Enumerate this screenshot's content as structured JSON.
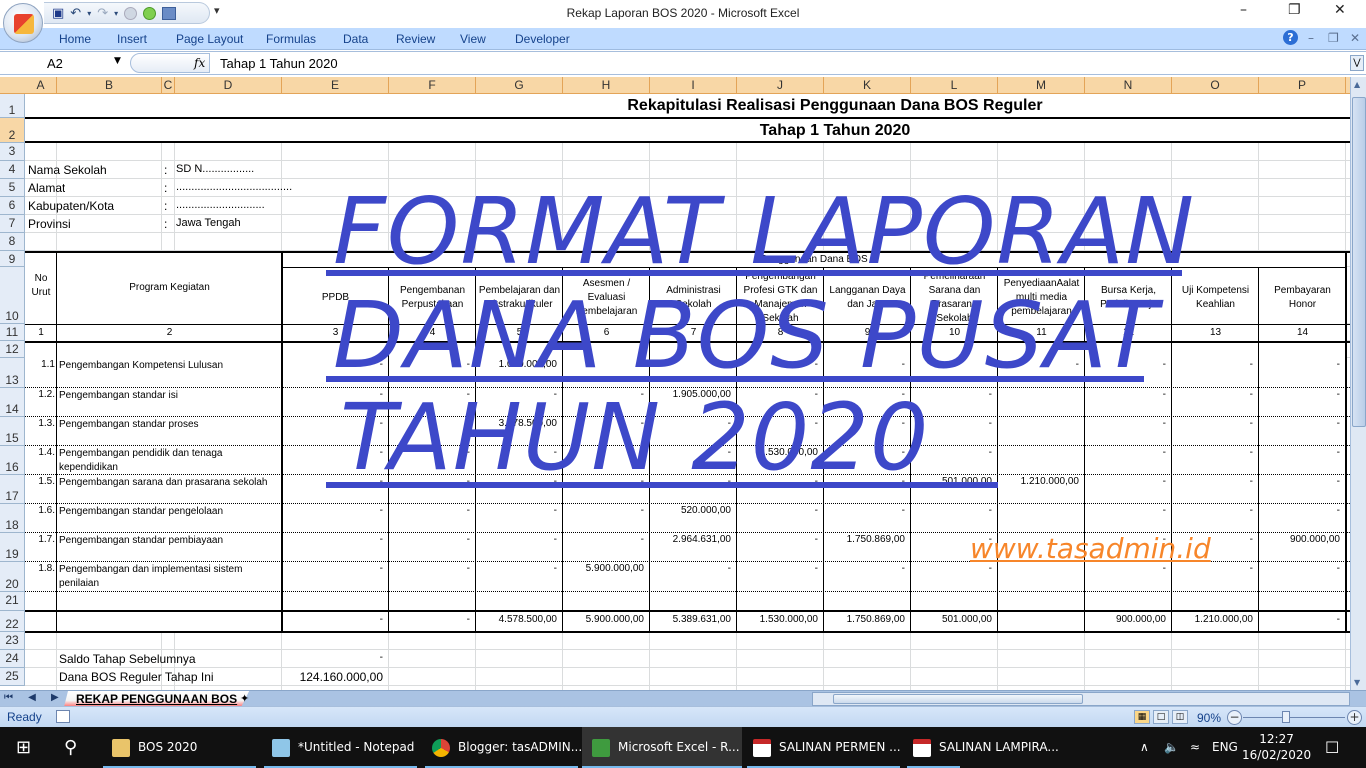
{
  "window": {
    "title": "Rekap Laporan BOS 2020 - Microsoft Excel",
    "minimize_icon": "minimize-icon",
    "restore_icon": "restore-icon",
    "close_icon": "close-icon"
  },
  "quick_access": {
    "save": "💾",
    "undo": "↶",
    "redo": "↷",
    "more": "≡"
  },
  "ribbon": {
    "tabs": [
      "Home",
      "Insert",
      "Page Layout",
      "Formulas",
      "Data",
      "Review",
      "View",
      "Developer"
    ],
    "help": "?"
  },
  "formula_bar": {
    "name_box": "A2",
    "fx": "fx",
    "value": "Tahap 1 Tahun 2020"
  },
  "columns": [
    "A",
    "B",
    "C",
    "D",
    "E",
    "F",
    "G",
    "H",
    "I",
    "J",
    "K",
    "L",
    "M",
    "N",
    "O",
    "P"
  ],
  "rows": [
    "1",
    "2",
    "3",
    "4",
    "5",
    "6",
    "7",
    "8",
    "9",
    "10",
    "11",
    "12",
    "13",
    "14",
    "15",
    "16",
    "17",
    "18",
    "19",
    "20",
    "21",
    "22",
    "23",
    "24",
    "25"
  ],
  "sheet": {
    "title": "Rekapitulasi Realisasi Penggunaan Dana BOS Reguler",
    "subtitle": "Tahap 1 Tahun 2020",
    "info": [
      {
        "label": "Nama Sekolah",
        "sep": ":",
        "value": "SD N................."
      },
      {
        "label": "Alamat",
        "sep": ":",
        "value": "......................................"
      },
      {
        "label": "Kabupaten/Kota",
        "sep": ":",
        "value": "............................."
      },
      {
        "label": "Provinsi",
        "sep": ":",
        "value": "Jawa Tengah"
      }
    ],
    "header": {
      "no_urut": "No Urut",
      "program": "Program Kegiatan",
      "group": "Penggunaan Dana BOS",
      "cols": [
        "PPDB",
        "Pengembanan Perpustakaan",
        "Pembelajaran dan Ekstrakurikuler",
        "Asesmen / Evaluasi Pembelajaran",
        "Administrasi Sekolah",
        "Pengembangan Profesi GTK dan Manajemen Sekolah",
        "Langganan Daya dan Jasa",
        "Pemeliharaan Sarana dan Prasarana Sekolah",
        "PenyediaanAalat multi media pembelajaran",
        "Bursa Kerja, Praktik Kerja",
        "Uji Kompetensi Keahlian",
        "Pembayaran Honor"
      ],
      "numbers": [
        "1",
        "2",
        "3",
        "4",
        "5",
        "6",
        "7",
        "8",
        "9",
        "10",
        "11",
        "12",
        "13",
        "14"
      ]
    },
    "items": [
      {
        "no": "1.1",
        "name": "Pengembangan Kompetensi Lulusan",
        "values": [
          "-",
          "-",
          "1.000.000,00",
          "-",
          "-",
          "-",
          "-",
          "-",
          "-",
          "-",
          "-",
          "-"
        ]
      },
      {
        "no": "1.2.",
        "name": "Pengembangan standar isi",
        "values": [
          "-",
          "-",
          "-",
          "-",
          "1.905.000,00",
          "-",
          "-",
          "-",
          "",
          "-",
          "-",
          "-"
        ]
      },
      {
        "no": "1.3.",
        "name": "Pengembangan standar proses",
        "values": [
          "-",
          "-",
          "3.578.500,00",
          "-",
          "-",
          "-",
          "-",
          "-",
          "",
          "-",
          "-",
          "-"
        ]
      },
      {
        "no": "1.4.",
        "name": "Pengembangan pendidik dan tenaga kependidikan",
        "values": [
          "-",
          "-",
          "-",
          "-",
          "-",
          "1.530.000,00",
          "-",
          "-",
          "",
          "-",
          "-",
          "-"
        ]
      },
      {
        "no": "1.5.",
        "name": "Pengembangan sarana dan prasarana sekolah",
        "values": [
          "-",
          "-",
          "-",
          "-",
          "-",
          "-",
          "-",
          "501.000,00",
          "1.210.000,00",
          "-",
          "-",
          "-"
        ]
      },
      {
        "no": "1.6.",
        "name": "Pengembangan standar pengelolaan",
        "values": [
          "-",
          "-",
          "-",
          "-",
          "520.000,00",
          "-",
          "-",
          "-",
          "",
          "-",
          "-",
          "-"
        ]
      },
      {
        "no": "1.7.",
        "name": "Pengembangan standar pembiayaan",
        "values": [
          "-",
          "-",
          "-",
          "-",
          "2.964.631,00",
          "-",
          "1.750.869,00",
          "-",
          "",
          "-",
          "-",
          "900.000,00"
        ]
      },
      {
        "no": "1.8.",
        "name": "Pengembangan dan implementasi sistem penilaian",
        "values": [
          "-",
          "-",
          "-",
          "5.900.000,00",
          "-",
          "-",
          "-",
          "-",
          "",
          "-",
          "-",
          "-"
        ]
      }
    ],
    "totals": [
      "-",
      "-",
      "4.578.500,00",
      "5.900.000,00",
      "5.389.631,00",
      "1.530.000,00",
      "1.750.869,00",
      "501.000,00",
      "",
      "900.000,00",
      "1.210.000,00",
      "-"
    ],
    "saldo_label": "Saldo Tahap Sebelumnya",
    "saldo_value": "-",
    "dana_label": "Dana BOS Reguler Tahap Ini",
    "dana_value": "124.160.000,00"
  },
  "watermark": {
    "line1": "FORMAT LAPORAN",
    "line2": "DANA BOS PUSAT",
    "line3": "TAHUN 2020",
    "url": "www.tasadmin.id",
    "color": "#3d48c9",
    "url_color": "#f7862a"
  },
  "sheet_tabs": {
    "active": "REKAP PENGGUNAAN BOS",
    "nav": "⏮ ◀ ▶ ⏭"
  },
  "status_bar": {
    "ready": "Ready",
    "zoom": "90%",
    "zoom_fraction": 0.9
  },
  "taskbar": {
    "items": [
      {
        "label": "BOS 2020",
        "icon": "folder-icon"
      },
      {
        "label": "*Untitled - Notepad",
        "icon": "notepad-icon"
      },
      {
        "label": "Blogger: tasADMIN...",
        "icon": "chrome-icon"
      },
      {
        "label": "Microsoft Excel - R...",
        "icon": "excel-icon",
        "active": true
      },
      {
        "label": "SALINAN PERMEN ...",
        "icon": "pdf-icon"
      },
      {
        "label": "SALINAN LAMPIRA...",
        "icon": "pdf-icon"
      }
    ],
    "lang": "ENG",
    "time": "12:27",
    "date": "16/02/2020"
  }
}
